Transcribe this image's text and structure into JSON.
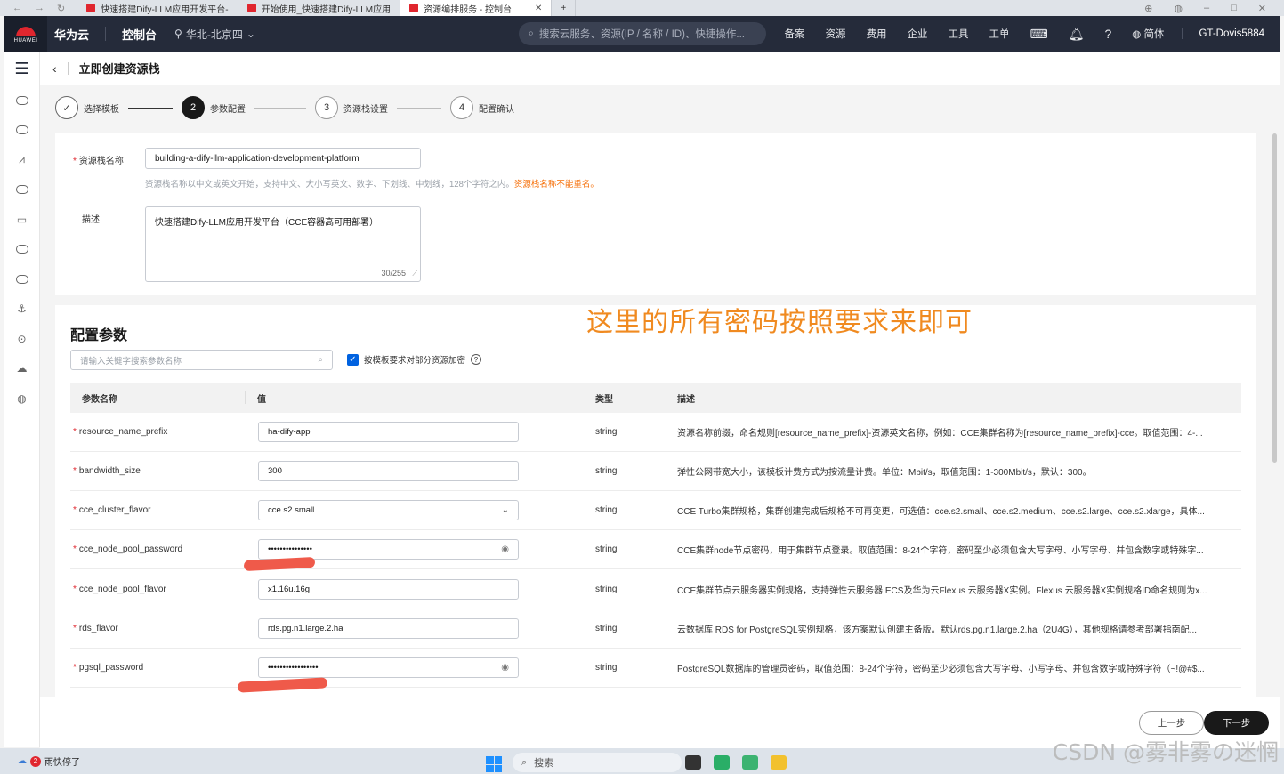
{
  "browser": {
    "tabs": [
      {
        "label": "快速搭建Dify-LLM应用开发平台-",
        "active": false
      },
      {
        "label": "开始使用_快速搭建Dify-LLM应用",
        "active": false
      },
      {
        "label": "资源编排服务 - 控制台",
        "active": true
      }
    ],
    "close": "✕"
  },
  "topbar": {
    "brand": "华为云",
    "console": "控制台",
    "region": "华北-北京四",
    "search_placeholder": "搜索云服务、资源(IP / 名称 / ID)、快捷操作...",
    "nav": [
      "备案",
      "资源",
      "费用",
      "企业",
      "工具",
      "工单"
    ],
    "lang": "简体",
    "user": "GT-Dovis5884",
    "logo_text": "HUAWEI"
  },
  "page": {
    "back_icon": "‹",
    "title": "立即创建资源栈"
  },
  "steps": [
    {
      "num": "✓",
      "label": "选择模板",
      "state": "done"
    },
    {
      "num": "2",
      "label": "参数配置",
      "state": "current"
    },
    {
      "num": "3",
      "label": "资源栈设置",
      "state": "todo"
    },
    {
      "num": "4",
      "label": "配置确认",
      "state": "todo"
    }
  ],
  "basic": {
    "name_label": "资源栈名称",
    "name_value": "building-a-dify-llm-application-development-platform",
    "name_hint": "资源栈名称以中文或英文开始，支持中文、大小写英文、数字、下划线、中划线，128个字符之内。",
    "name_warn": "资源栈名称不能重名。",
    "desc_label": "描述",
    "desc_value": "快速搭建Dify-LLM应用开发平台（CCE容器高可用部署）",
    "desc_counter": "30/255"
  },
  "annotation": "这里的所有密码按照要求来即可",
  "params": {
    "title": "配置参数",
    "search_placeholder": "请输入关键字搜索参数名称",
    "encrypt_label": "按模板要求对部分资源加密",
    "headers": {
      "name": "参数名称",
      "value": "值",
      "type": "类型",
      "desc": "描述"
    },
    "rows": [
      {
        "name": "resource_name_prefix",
        "value": "ha-dify-app",
        "kind": "text",
        "type": "string",
        "desc": "资源名称前缀，命名规则[resource_name_prefix]-资源英文名称，例如：CCE集群名称为[resource_name_prefix]-cce。取值范围：4-..."
      },
      {
        "name": "bandwidth_size",
        "value": "300",
        "kind": "text",
        "type": "string",
        "desc": "弹性公网带宽大小，该模板计费方式为按流量计费。单位：Mbit/s，取值范围：1-300Mbit/s，默认：300。"
      },
      {
        "name": "cce_cluster_flavor",
        "value": "cce.s2.small",
        "kind": "select",
        "type": "string",
        "desc": "CCE Turbo集群规格，集群创建完成后规格不可再变更，可选值：cce.s2.small、cce.s2.medium、cce.s2.large、cce.s2.xlarge，具体..."
      },
      {
        "name": "cce_node_pool_password",
        "value": "•••••••••••••••",
        "kind": "password",
        "type": "string",
        "desc": "CCE集群node节点密码，用于集群节点登录。取值范围：8-24个字符，密码至少必须包含大写字母、小写字母、并包含数字或特殊字..."
      },
      {
        "name": "cce_node_pool_flavor",
        "value": "x1.16u.16g",
        "kind": "text",
        "type": "string",
        "desc": "CCE集群节点云服务器实例规格，支持弹性云服务器 ECS及华为云Flexus 云服务器X实例。Flexus 云服务器X实例规格ID命名规则为x..."
      },
      {
        "name": "rds_flavor",
        "value": "rds.pg.n1.large.2.ha",
        "kind": "text",
        "type": "string",
        "desc": "云数据库 RDS for PostgreSQL实例规格，该方案默认创建主备版。默认rds.pg.n1.large.2.ha（2U4G），其他规格请参考部署指南配..."
      },
      {
        "name": "pgsql_password",
        "value": "•••••••••••••••••",
        "kind": "password",
        "type": "string",
        "desc": "PostgreSQL数据库的管理员密码，取值范围：8-24个字符，密码至少必须包含大写字母、小写字母、并包含数字或特殊字符（~!@#$..."
      }
    ]
  },
  "footer": {
    "prev": "上一步",
    "next": "下一步"
  },
  "taskbar": {
    "weather": "雨快停了",
    "weather_badge": "2",
    "search": "搜索"
  },
  "watermark": "CSDN @雾非雾の迷惘"
}
